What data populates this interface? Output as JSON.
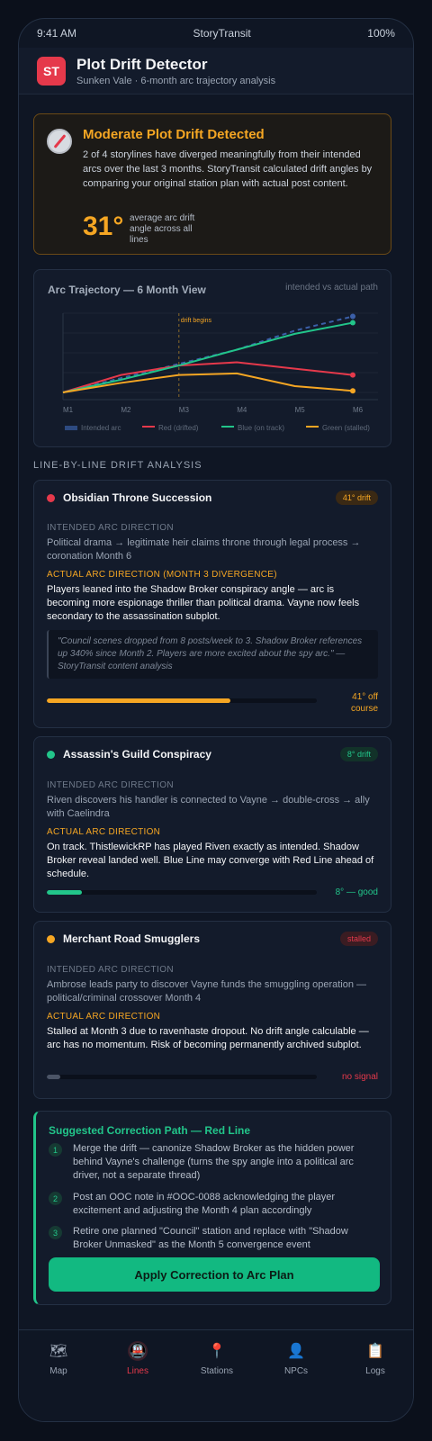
{
  "status": {
    "time": "9:41 AM",
    "carrier": "StoryTransit",
    "battery": "100%"
  },
  "header": {
    "logo": "ST",
    "title": "Plot Drift Detector",
    "subtitle": "Sunken Vale · 6-month arc trajectory analysis"
  },
  "alert": {
    "title": "Moderate Plot Drift Detected",
    "body": "2 of 4 storylines have diverged meaningfully from their intended arcs over the last 3 months. StoryTransit calculated drift angles by comparing your original station plan with actual post content.",
    "angle": "31°",
    "angle_note": "average arc drift angle across all lines",
    "icon": "compass-icon"
  },
  "chart": {
    "title": "Arc Trajectory — 6 Month View",
    "subtitle": "intended vs actual path",
    "annotation": "drift begins"
  },
  "chart_data": {
    "type": "line",
    "categories": [
      "M1",
      "M2",
      "M3",
      "M4",
      "M5",
      "M6"
    ],
    "ylim": [
      0,
      100
    ],
    "grid": true,
    "legend_placement": "bottom",
    "series": [
      {
        "name": "Intended arc",
        "color": "#3b5fa8",
        "dashed": true,
        "values": [
          0,
          18,
          36,
          54,
          78,
          96
        ]
      },
      {
        "name": "Red (drifted)",
        "color": "#e5394b",
        "values": [
          0,
          22,
          34,
          38,
          30,
          22
        ]
      },
      {
        "name": "Blue (on track)",
        "color": "#22c58a",
        "values": [
          0,
          16,
          34,
          54,
          74,
          88
        ]
      },
      {
        "name": "Green (stalled)",
        "color": "#f5a623",
        "values": [
          0,
          12,
          22,
          24,
          8,
          2
        ]
      }
    ]
  },
  "section_label": "LINE-BY-LINE DRIFT ANALYSIS",
  "lines": [
    {
      "name": "Obsidian Throne Succession",
      "color": "#e5394b",
      "badge": "41° drift",
      "intended_label": "INTENDED ARC DIRECTION",
      "intended": "Political drama → legitimate heir claims throne through legal process → coronation Month 6",
      "actual_label": "ACTUAL ARC DIRECTION (MONTH 3 DIVERGENCE)",
      "actual": "Players leaned into the Shadow Broker conspiracy angle — arc is becoming more espionage thriller than political drama. Vayne now feels secondary to the assassination subplot.",
      "quote": "\"Council scenes dropped from 8 posts/week to 3. Shadow Broker references up 340% since Month 2. Players are more excited about the spy arc.\" — StoryTransit content analysis",
      "drift_fraction": 0.68,
      "drift_note": "41° off course"
    },
    {
      "name": "Assassin's Guild Conspiracy",
      "color": "#22c58a",
      "badge": "8° drift",
      "intended_label": "INTENDED ARC DIRECTION",
      "intended": "Riven discovers his handler is connected to Vayne → double-cross → ally with Caelindra",
      "actual_label": "ACTUAL ARC DIRECTION",
      "actual": "On track. ThistlewickRP has played Riven exactly as intended. Shadow Broker reveal landed well. Blue Line may converge with Red Line ahead of schedule.",
      "drift_fraction": 0.13,
      "drift_note": "8° — good"
    },
    {
      "name": "Merchant Road Smugglers",
      "color": "#f5a623",
      "badge": "stalled",
      "intended_label": "INTENDED ARC DIRECTION",
      "intended": "Ambrose leads party to discover Vayne funds the smuggling operation — political/criminal crossover Month 4",
      "actual_label": "ACTUAL ARC DIRECTION",
      "actual": "Stalled at Month 3 due to ravenhaste dropout. No drift angle calculable — arc has no momentum. Risk of becoming permanently archived subplot.",
      "drift_fraction": 0.05,
      "drift_note": "no signal"
    }
  ],
  "correction": {
    "title": "Suggested Correction Path — Red Line",
    "steps": [
      {
        "num": "1",
        "text": "Merge the drift — canonize Shadow Broker as the hidden power behind Vayne's challenge (turns the spy angle into a political arc driver, not a separate thread)"
      },
      {
        "num": "2",
        "text": "Post an OOC note in #OOC-0088 acknowledging the player excitement and adjusting the Month 4 plan accordingly"
      },
      {
        "num": "3",
        "text": "Retire one planned \"Council\" station and replace with \"Shadow Broker Unmasked\" as the Month 5 convergence event"
      }
    ],
    "button": "Apply Correction to Arc Plan"
  },
  "tabs": [
    {
      "label": "Map",
      "icon": "map-icon",
      "glyph": "🗺"
    },
    {
      "label": "Lines",
      "icon": "train-icon",
      "glyph": "🚇"
    },
    {
      "label": "Stations",
      "icon": "pin-icon",
      "glyph": "📍"
    },
    {
      "label": "NPCs",
      "icon": "person-icon",
      "glyph": "👤"
    },
    {
      "label": "Logs",
      "icon": "clipboard-icon",
      "glyph": "📋"
    }
  ]
}
